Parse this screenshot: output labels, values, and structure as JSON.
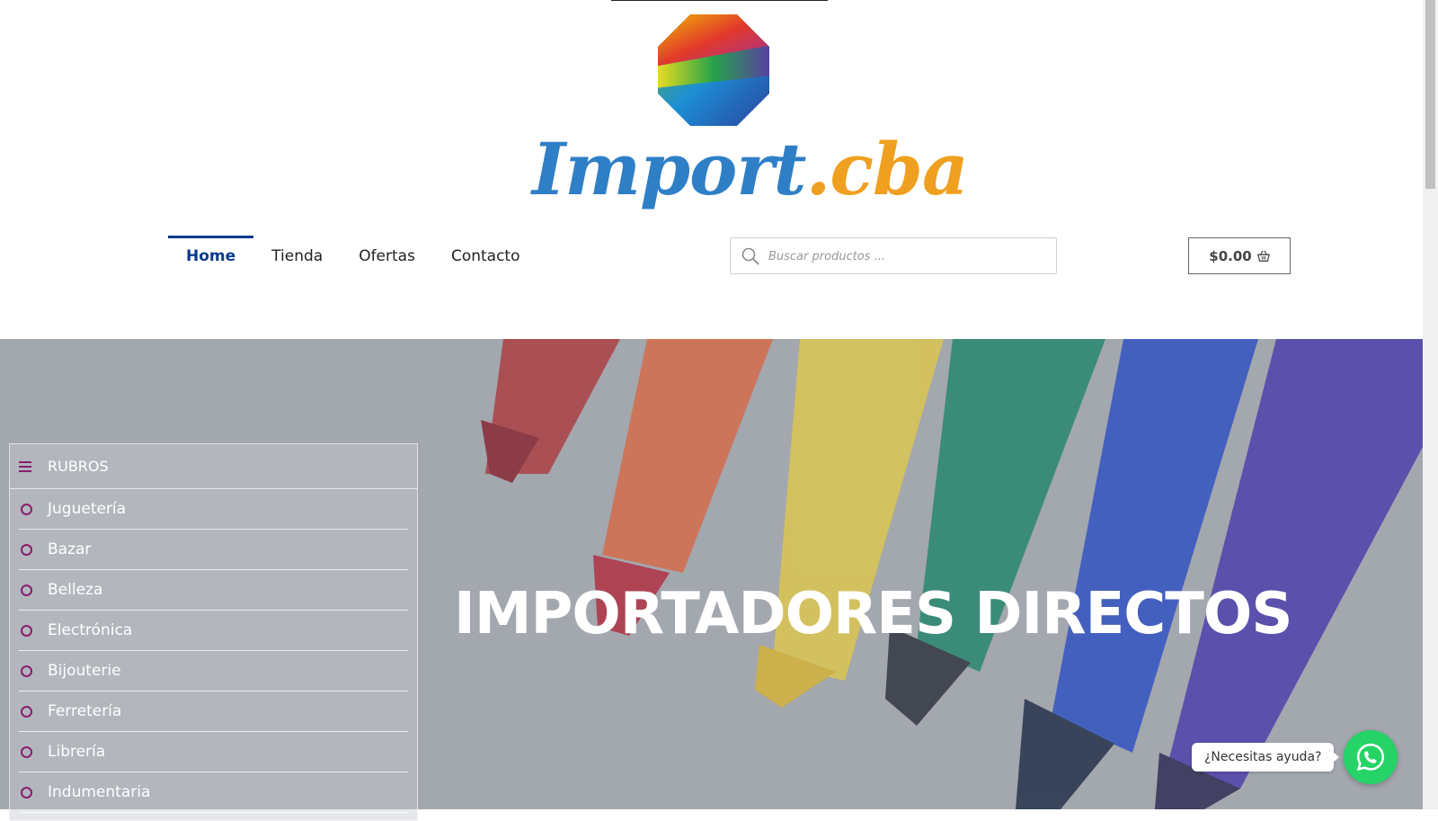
{
  "brand": {
    "name_part1": "Import",
    "name_part2": ".cba"
  },
  "nav": {
    "items": [
      {
        "label": "Home",
        "active": true
      },
      {
        "label": "Tienda",
        "active": false
      },
      {
        "label": "Ofertas",
        "active": false
      },
      {
        "label": "Contacto",
        "active": false
      }
    ]
  },
  "search": {
    "placeholder": "Buscar productos ...",
    "icon": "search-icon"
  },
  "cart": {
    "total": "$0.00",
    "icon": "basket-icon"
  },
  "hero": {
    "title": "IMPORTADORES DIRECTOS"
  },
  "rubros": {
    "title": "RUBROS",
    "icon": "menu-icon",
    "items": [
      {
        "label": "Juguetería"
      },
      {
        "label": "Bazar"
      },
      {
        "label": "Belleza"
      },
      {
        "label": "Electrónica"
      },
      {
        "label": "Bijouterie"
      },
      {
        "label": "Ferretería"
      },
      {
        "label": "Librería"
      },
      {
        "label": "Indumentaria"
      }
    ]
  },
  "whatsapp": {
    "bubble_text": "¿Necesitas ayuda?",
    "icon": "whatsapp-icon"
  },
  "colors": {
    "nav_active": "#0b3a8c",
    "accent_purple": "#8a1d6e",
    "whatsapp_green": "#25d366"
  }
}
